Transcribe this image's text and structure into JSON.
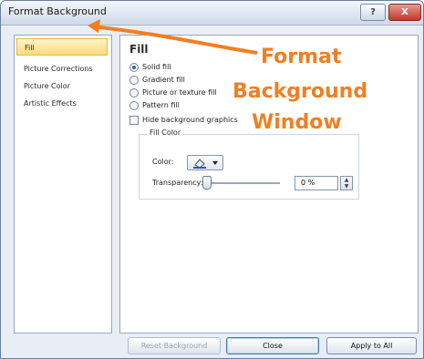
{
  "window": {
    "title": "Format Background",
    "help_label": "?",
    "close_label": "X"
  },
  "sidebar": {
    "items": [
      {
        "label": "Fill",
        "selected": true
      },
      {
        "label": "Picture Corrections",
        "selected": false
      },
      {
        "label": "Picture Color",
        "selected": false
      },
      {
        "label": "Artistic Effects",
        "selected": false
      }
    ]
  },
  "panel": {
    "title": "Fill",
    "options": [
      {
        "label": "Solid fill",
        "type": "radio",
        "checked": true
      },
      {
        "label": "Gradient fill",
        "type": "radio",
        "checked": false
      },
      {
        "label": "Picture or texture fill",
        "type": "radio",
        "checked": false
      },
      {
        "label": "Pattern fill",
        "type": "radio",
        "checked": false
      },
      {
        "label": "Hide background graphics",
        "type": "checkbox",
        "checked": false
      }
    ],
    "fill_color": {
      "legend": "Fill Color",
      "color_label": "Color:",
      "transparency_label": "Transparency:",
      "transparency_value": "0 %"
    }
  },
  "buttons": {
    "reset": "Reset Background",
    "close": "Close",
    "apply_all": "Apply to All"
  },
  "annotation": {
    "line1": "Format",
    "line2": "Background",
    "line3": "Window",
    "color": "#f07f22"
  }
}
